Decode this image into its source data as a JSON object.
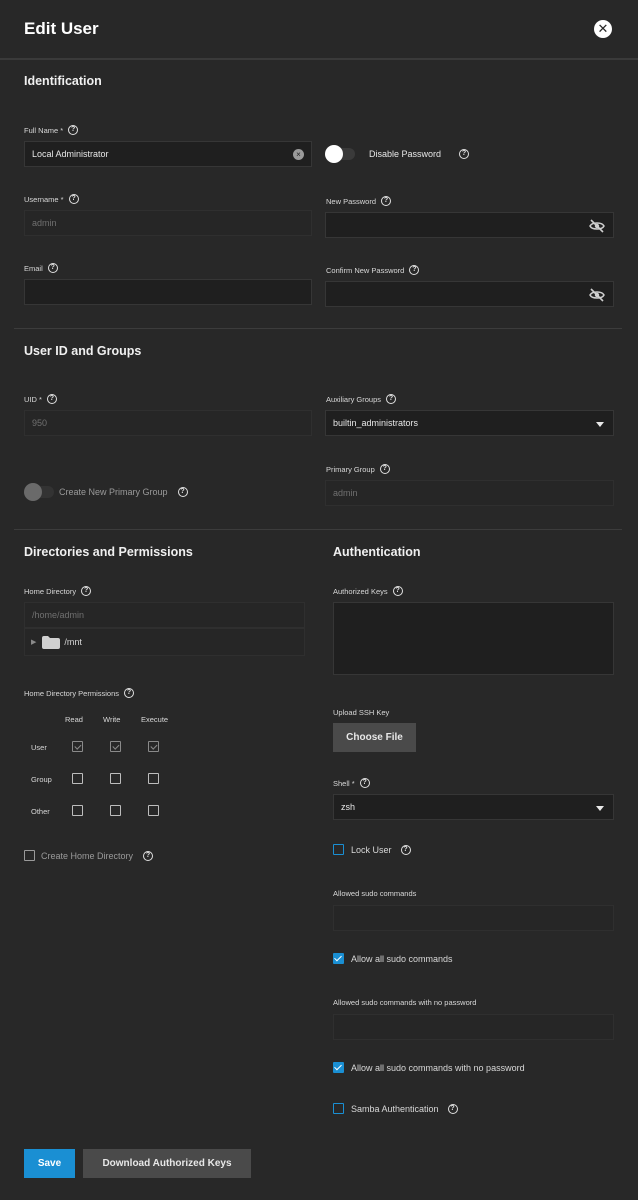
{
  "header": {
    "title": "Edit User",
    "close_icon": "close-icon"
  },
  "identification": {
    "title": "Identification",
    "full_name_label": "Full Name *",
    "full_name_value": "Local Administrator",
    "disable_password_label": "Disable Password",
    "username_label": "Username *",
    "username_value": "admin",
    "new_password_label": "New Password",
    "email_label": "Email",
    "confirm_password_label": "Confirm New Password"
  },
  "groups": {
    "title": "User ID and Groups",
    "uid_label": "UID *",
    "uid_value": "950",
    "aux_groups_label": "Auxiliary Groups",
    "aux_groups_value": "builtin_administrators",
    "create_primary_label": "Create New Primary Group",
    "primary_group_label": "Primary Group",
    "primary_group_value": "admin"
  },
  "directories": {
    "title": "Directories and Permissions",
    "home_dir_label": "Home Directory",
    "home_dir_value": "/home/admin",
    "tree_item": "/mnt",
    "perms_label": "Home Directory Permissions",
    "perm_columns": [
      "Read",
      "Write",
      "Execute"
    ],
    "perm_rows": [
      "User",
      "Group",
      "Other"
    ],
    "create_home_label": "Create Home Directory"
  },
  "auth": {
    "title": "Authentication",
    "authorized_keys_label": "Authorized Keys",
    "upload_ssh_label": "Upload SSH Key",
    "choose_file_label": "Choose File",
    "shell_label": "Shell *",
    "shell_value": "zsh",
    "lock_user_label": "Lock User",
    "sudo_commands_label": "Allowed sudo commands",
    "allow_all_sudo_label": "Allow all sudo commands",
    "sudo_nopass_label": "Allowed sudo commands with no password",
    "allow_all_nopass_label": "Allow all sudo commands with no password",
    "samba_label": "Samba Authentication"
  },
  "footer": {
    "save_label": "Save",
    "download_keys_label": "Download Authorized Keys"
  },
  "colors": {
    "accent": "#1a8fd3",
    "background": "#282828",
    "input_bg": "#1f1f1f"
  }
}
